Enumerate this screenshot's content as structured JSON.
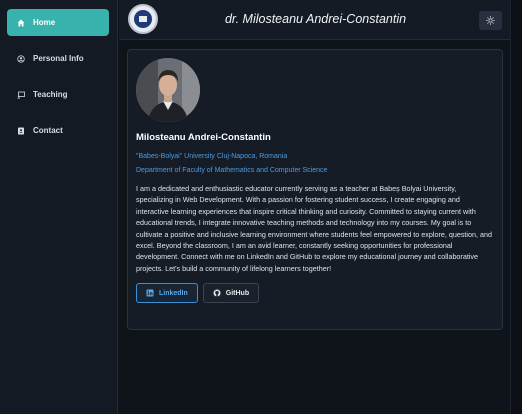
{
  "sidebar": {
    "items": [
      {
        "label": "Home",
        "icon": "home-icon",
        "active": true
      },
      {
        "label": "Personal Info",
        "icon": "user-circle-icon",
        "active": false
      },
      {
        "label": "Teaching",
        "icon": "chalkboard-icon",
        "active": false
      },
      {
        "label": "Contact",
        "icon": "address-card-icon",
        "active": false
      }
    ]
  },
  "header": {
    "title": "dr. Milosteanu Andrei-Constantin",
    "logo_icon": "university-seal-icon",
    "theme_icon": "sun-icon"
  },
  "profile": {
    "name": "Milosteanu Andrei-Constantin",
    "affiliation": "\"Babes-Bolyai\" University Cluj-Napoca, Romania",
    "department": "Department of Faculty of Mathematics and Computer Science",
    "bio": "I am a dedicated and enthusiastic educator currently serving as a teacher at Babeș Bolyai University, specializing in Web Development. With a passion for fostering student success, I create engaging and interactive learning experiences that inspire critical thinking and curiosity. Committed to staying current with educational trends, I integrate innovative teaching methods and technology into my courses. My goal is to cultivate a positive and inclusive learning environment where students feel empowered to explore, question, and excel. Beyond the classroom, I am an avid learner, constantly seeking opportunities for professional development. Connect with me on LinkedIn and GitHub to explore my educational journey and collaborative projects. Let's build a community of lifelong learners together!",
    "links": [
      {
        "label": "LinkedIn",
        "icon": "linkedin-icon"
      },
      {
        "label": "GitHub",
        "icon": "github-icon"
      }
    ]
  },
  "colors": {
    "accent": "#38b2ac",
    "link": "#4d9be0",
    "background": "#0f131a"
  }
}
